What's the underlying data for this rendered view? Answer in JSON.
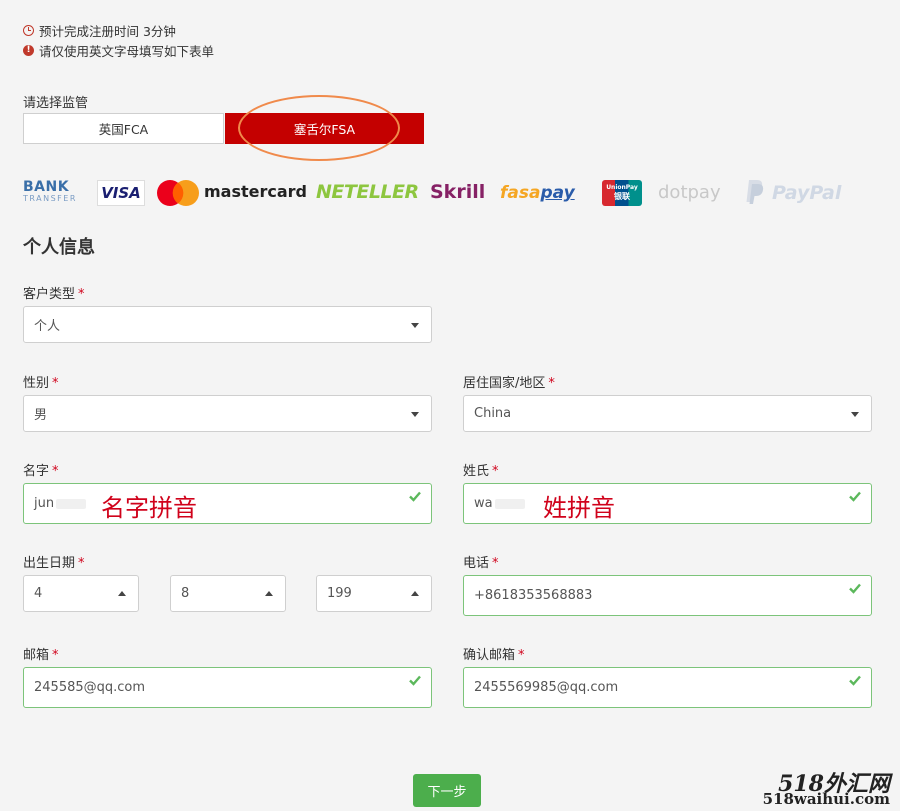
{
  "notices": {
    "time": "预计完成注册时间 3分钟",
    "english_only": "请仅使用英文字母填写如下表单"
  },
  "regulator": {
    "label": "请选择监管",
    "options": [
      "英国FCA",
      "塞舌尔FSA"
    ],
    "selected": "塞舌尔FSA"
  },
  "payment_logos": {
    "bank_transfer": {
      "line1": "BANK",
      "line2": "TRANSFER"
    },
    "visa": "VISA",
    "mastercard": "mastercard",
    "neteller": "NETELLER",
    "skrill": "Skrill",
    "fasapay": {
      "a": "fasa",
      "b": "pay"
    },
    "unionpay": {
      "line1": "UnionPay",
      "line2": "银联"
    },
    "dotpay": "dotpay",
    "paypal": "PayPal"
  },
  "section_title": "个人信息",
  "customer_type": {
    "label": "客户类型",
    "value": "个人"
  },
  "gender": {
    "label": "性别",
    "value": "男"
  },
  "country": {
    "label": "居住国家/地区",
    "value": "China"
  },
  "first_name": {
    "label": "名字",
    "value": "jun",
    "annotation": "名字拼音"
  },
  "last_name": {
    "label": "姓氏",
    "value": "wa",
    "annotation": "姓拼音"
  },
  "birth": {
    "label": "出生日期",
    "day": "4",
    "month": "8",
    "year": "199"
  },
  "phone": {
    "label": "电话",
    "value": "+8618353568883"
  },
  "email": {
    "label": "邮箱",
    "value": "2455⁠⁠⁠85@qq.com"
  },
  "confirm_email": {
    "label": "确认邮箱",
    "value": "2455569985@qq.com"
  },
  "required_mark": "*",
  "next_button": "下一步",
  "watermark": {
    "line1": "518外汇网",
    "line2": "518waihui.com"
  },
  "colors": {
    "accent_red": "#c40000",
    "valid_green": "#7cc47a",
    "button_green": "#4cae4c"
  }
}
